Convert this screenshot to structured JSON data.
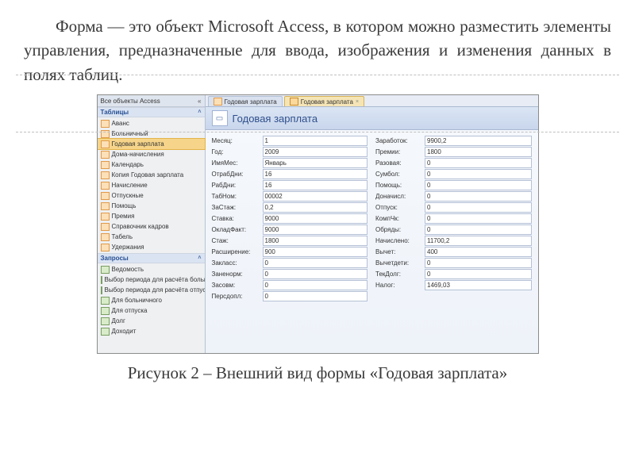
{
  "paragraph": "Форма — это объект Microsoft Access, в котором можно разместить элементы управления, предназначенные для ввода, изображения и изменения данных в полях таблиц.",
  "caption": "Рисунок 2 – Внешний вид формы «Годовая зарплата»",
  "access": {
    "nav_title": "Все объекты Access",
    "section_tables": "Таблицы",
    "section_queries": "Запросы",
    "tables": [
      "Аванс",
      "Больничный",
      "Годовая зарплата",
      "Дома-начисления",
      "Календарь",
      "Копия Годовая зарплата",
      "Начисление",
      "Отпускные",
      "Помощь",
      "Премия",
      "Справочник кадров",
      "Табель",
      "Удержания"
    ],
    "queries": [
      "Ведомость",
      "Выбор периода для расчёта больн...",
      "Выбор периода для расчёта отпуска",
      "Для больничного",
      "Для отпуска",
      "Долг",
      "Доходит"
    ],
    "tab1": "Годовая зарплата",
    "tab2": "Годовая зарплата",
    "form_title": "Годовая зарплата",
    "fields_left": [
      {
        "label": "Месяц:",
        "value": "1"
      },
      {
        "label": "Год:",
        "value": "2009"
      },
      {
        "label": "ИмяМес:",
        "value": "Январь"
      },
      {
        "label": "ОтрабДни:",
        "value": "16"
      },
      {
        "label": "РабДни:",
        "value": "16"
      },
      {
        "label": "ТабНом:",
        "value": "00002"
      },
      {
        "label": "ЗаСтаж:",
        "value": "0,2"
      },
      {
        "label": "Ставка:",
        "value": "9000"
      },
      {
        "label": "ОкладФакт:",
        "value": "9000"
      },
      {
        "label": "Стаж:",
        "value": "1800"
      },
      {
        "label": "Расширение:",
        "value": "900"
      },
      {
        "label": "Закласс:",
        "value": "0"
      },
      {
        "label": "Заненорм:",
        "value": "0"
      },
      {
        "label": "Засовм:",
        "value": "0"
      },
      {
        "label": "Персдопл:",
        "value": "0"
      }
    ],
    "fields_right": [
      {
        "label": "Заработок:",
        "value": "9900,2"
      },
      {
        "label": "Премии:",
        "value": "1800"
      },
      {
        "label": "Разовая:",
        "value": "0"
      },
      {
        "label": "Сумбол:",
        "value": "0"
      },
      {
        "label": "Помощь:",
        "value": "0"
      },
      {
        "label": "Доначисл:",
        "value": "0"
      },
      {
        "label": "Отпуск:",
        "value": "0"
      },
      {
        "label": "КомпЧк:",
        "value": "0"
      },
      {
        "label": "Обряды:",
        "value": "0"
      },
      {
        "label": "Начислено:",
        "value": "11700,2"
      },
      {
        "label": "Вычет:",
        "value": "400"
      },
      {
        "label": "Вычетдети:",
        "value": "0"
      },
      {
        "label": "ТекДолг:",
        "value": "0"
      },
      {
        "label": "Налог:",
        "value": "1469,03"
      }
    ]
  }
}
